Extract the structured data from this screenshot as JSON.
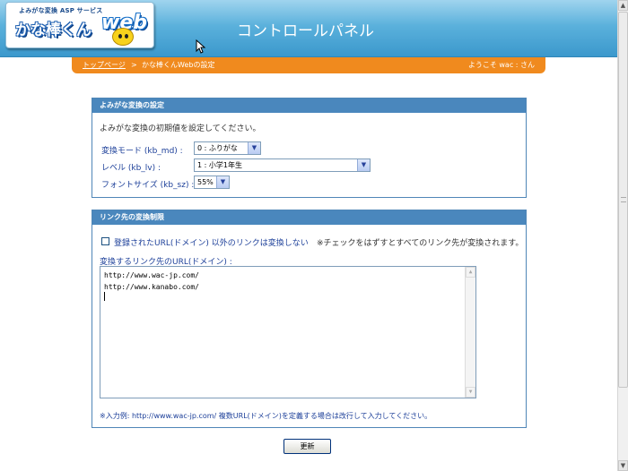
{
  "header": {
    "logo_sub": "よみがな変換 ASP サービス",
    "logo_main": "かな棒くん",
    "logo_web": "web",
    "title": "コントロールパネル"
  },
  "breadcrumb": {
    "top_link": "トップページ",
    "separator": ">",
    "current": "かな棒くんWebの設定",
    "welcome": "ようこそ wac : さん"
  },
  "yomigana": {
    "title": "よみがな変換の設定",
    "description": "よみがな変換の初期値を設定してください。",
    "fields": [
      {
        "label": "変換モード (kb_md) :",
        "value": "0 : ふりがな"
      },
      {
        "label": "レベル (kb_lv) :",
        "value": "1 : 小学1年生"
      },
      {
        "label": "フォントサイズ (kb_sz) :",
        "value": "55%"
      }
    ]
  },
  "link": {
    "title": "リンク先の変換制限",
    "checkbox_label": "登録されたURL(ドメイン) 以外のリンクは変換しない",
    "checkbox_checked": false,
    "note": "※チェックをはずすとすべてのリンク先が変換されます。",
    "textarea_label": "変換するリンク先のURL(ドメイン) :",
    "urls": [
      "http://www.wac-jp.com/",
      "http://www.kanabo.com/"
    ],
    "example": "※入力例: http://www.wac-jp.com/ 複数URL(ドメイン)を定義する場合は改行して入力してください。"
  },
  "actions": {
    "update_label": "更新"
  },
  "colors": {
    "header_blue": "#3b98cc",
    "crumb_orange": "#f08a1e",
    "panel_blue": "#4a87bd",
    "label_blue": "#1c3f99"
  }
}
